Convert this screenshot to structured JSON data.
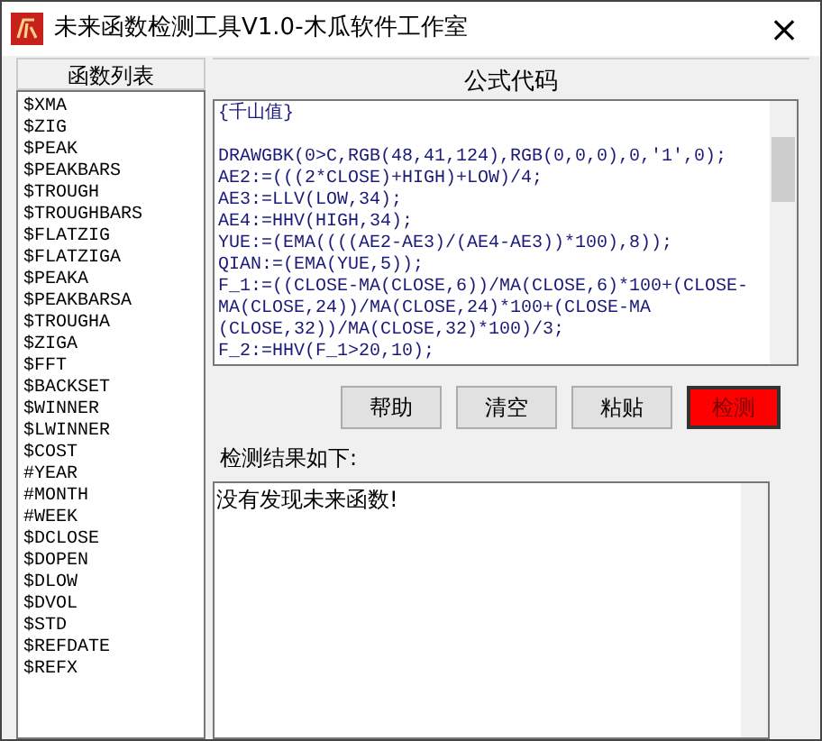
{
  "window": {
    "title": "未来函数检测工具V1.0-木瓜软件工作室",
    "close": "×"
  },
  "function_list": {
    "header": "函数列表",
    "items": [
      "$XMA",
      "$ZIG",
      "$PEAK",
      "$PEAKBARS",
      "$TROUGH",
      "$TROUGHBARS",
      "$FLATZIG",
      "$FLATZIGA",
      "$PEAKA",
      "$PEAKBARSA",
      "$TROUGHA",
      "$ZIGA",
      "$FFT",
      "$BACKSET",
      "$WINNER",
      "$LWINNER",
      "$COST",
      "#YEAR",
      "#MONTH",
      "#WEEK",
      "$DCLOSE",
      "$DOPEN",
      "$DLOW",
      "$DVOL",
      "$STD",
      "$REFDATE",
      "$REFX"
    ]
  },
  "formula": {
    "header": "公式代码",
    "lines": [
      "{千山值}",
      "DRAWGBK(0>C,RGB(48,41,124),RGB(0,0,0),0,'1',0);",
      "AE2:=(((2*CLOSE)+HIGH)+LOW)/4;",
      "AE3:=LLV(LOW,34);",
      "AE4:=HHV(HIGH,34);",
      "YUE:=(EMA((((AE2-AE3)/(AE4-AE3))*100),8));",
      "QIAN:=(EMA(YUE,5));",
      "F_1:=((CLOSE-MA(CLOSE,6))/MA(CLOSE,6)*100+(CLOSE-",
      "MA(CLOSE,24))/MA(CLOSE,24)*100+(CLOSE-MA",
      "(CLOSE,32))/MA(CLOSE,32)*100)/3;",
      "F_2:=HHV(F_1>20,10);"
    ]
  },
  "buttons": [
    {
      "label": "帮助",
      "kind": "normal"
    },
    {
      "label": "清空",
      "kind": "normal"
    },
    {
      "label": "粘贴",
      "kind": "normal"
    },
    {
      "label": "检测",
      "kind": "primary"
    }
  ],
  "result": {
    "label": "检测结果如下:",
    "text": "没有发现未来函数!"
  }
}
